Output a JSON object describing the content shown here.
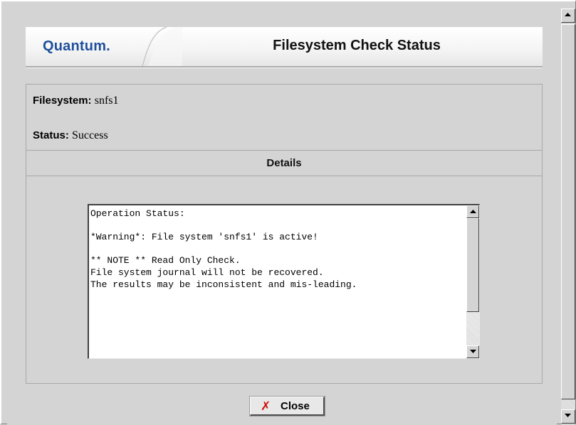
{
  "header": {
    "logo_text": "Quantum.",
    "title": "Filesystem Check Status"
  },
  "info": {
    "filesystem_label": "Filesystem:",
    "filesystem_value": "snfs1",
    "status_label": "Status:",
    "status_value": "Success"
  },
  "details": {
    "heading": "Details",
    "output": "Operation Status:\n\n*Warning*: File system 'snfs1' is active!\n\n** NOTE ** Read Only Check.\nFile system journal will not be recovered.\nThe results may be inconsistent and mis-leading."
  },
  "footer": {
    "close_label": "Close",
    "close_icon": "close-x-icon"
  },
  "colors": {
    "logo_blue": "#1f4f9c",
    "close_icon_red": "#d01010",
    "background": "#d4d4d4"
  }
}
